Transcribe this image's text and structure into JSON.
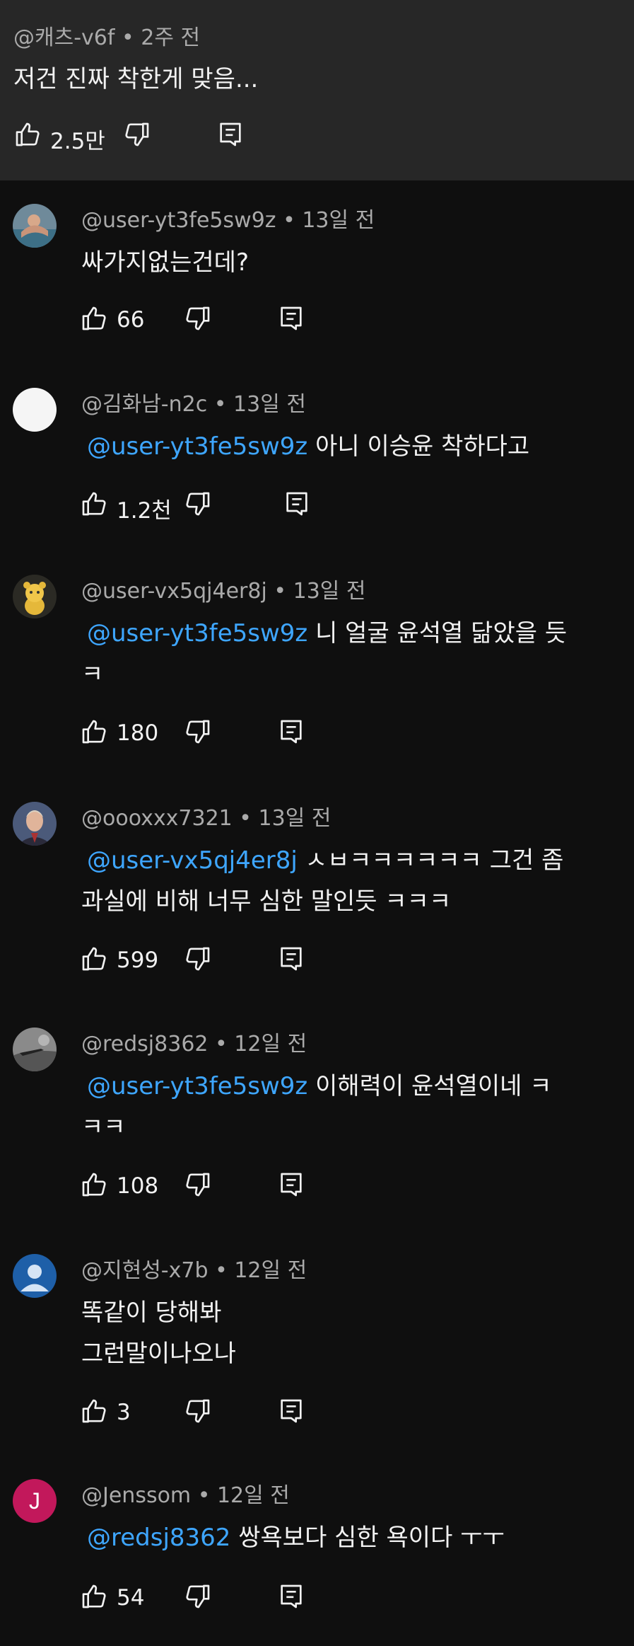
{
  "top_comment": {
    "author": "@캐츠-v6f",
    "time": "2주 전",
    "text": "저건 진짜 착한게 맞음...",
    "likes": "2.5만"
  },
  "separator": "•",
  "replies": [
    {
      "author": "@user-yt3fe5sw9z",
      "time": "13일 전",
      "mention": "",
      "lines": [
        "싸가지없는건데?"
      ],
      "likes": "66",
      "avatar": "photo-swimmer"
    },
    {
      "author": "@김화남-n2c",
      "time": "13일 전",
      "mention": "@user-yt3fe5sw9z",
      "lines": [
        "아니 이승윤 착하다고"
      ],
      "likes": "1.2천",
      "avatar": "white-circle"
    },
    {
      "author": "@user-vx5qj4er8j",
      "time": "13일 전",
      "mention": "@user-yt3fe5sw9z",
      "lines": [
        "니 얼굴 윤석열 닮았을 듯",
        "ㅋ"
      ],
      "likes": "180",
      "avatar": "yellow-character"
    },
    {
      "author": "@oooxxx7321",
      "time": "13일 전",
      "mention": "@user-vx5qj4er8j",
      "lines": [
        "ㅅㅂㅋㅋㅋㅋㅋㅋ 그건 좀",
        "과실에 비해 너무 심한 말인듯 ㅋㅋㅋ"
      ],
      "likes": "599",
      "avatar": "portrait-painting"
    },
    {
      "author": "@redsj8362",
      "time": "12일 전",
      "mention": "@user-yt3fe5sw9z",
      "lines": [
        "이해력이 윤석열이네 ㅋ",
        "ㅋㅋ"
      ],
      "likes": "108",
      "avatar": "gray-photo"
    },
    {
      "author": "@지현성-x7b",
      "time": "12일 전",
      "mention": "",
      "lines": [
        "똑같이 당해봐",
        "그런말이나오나"
      ],
      "likes": "3",
      "avatar": "default-person"
    },
    {
      "author": "@Jenssom",
      "time": "12일 전",
      "mention": "@redsj8362",
      "lines": [
        "쌍욕보다 심한 욕이다 ㅜㅜ"
      ],
      "likes": "54",
      "avatar": "letter-avatar",
      "avatar_letter": "J"
    }
  ],
  "colors": {
    "background": "#0f0f0f",
    "highlight": "#272727",
    "mention": "#3ea6ff",
    "secondary_text": "#aaaaaa",
    "avatar_j": "#c2185b",
    "avatar_default": "#1e5fa8"
  },
  "icons": {
    "like": "thumbs-up-icon",
    "dislike": "thumbs-down-icon",
    "reply": "reply-icon"
  }
}
